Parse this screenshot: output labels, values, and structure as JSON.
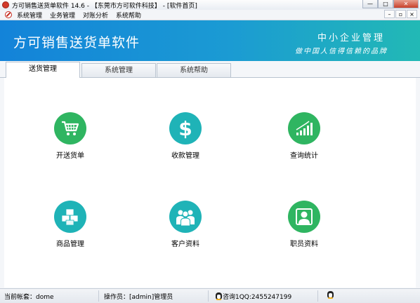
{
  "window": {
    "title": "方可销售送货单软件 14.6 - 【东莞市方可软件科技】 - [软件首页]",
    "min_label": "—",
    "max_label": "□",
    "close_label": "✕"
  },
  "menu": {
    "items": [
      {
        "label": "系统管理"
      },
      {
        "label": "业务管理"
      },
      {
        "label": "对账分析"
      },
      {
        "label": "系统帮助"
      }
    ],
    "mdi": [
      "–",
      "▫",
      "×"
    ]
  },
  "banner": {
    "app_name": "方可销售送货单软件",
    "tagline_main": "中小企业管理",
    "tagline_sub": "做中国人信得信赖的品牌"
  },
  "tabs": [
    {
      "label": "送货管理",
      "active": true
    },
    {
      "label": "系统管理",
      "active": false
    },
    {
      "label": "系统帮助",
      "active": false
    }
  ],
  "tiles": [
    {
      "label": "开送货单",
      "icon": "shopping-cart-icon",
      "color": "#2fb561"
    },
    {
      "label": "收款管理",
      "icon": "dollar-icon",
      "color": "#1fb3b7"
    },
    {
      "label": "查询统计",
      "icon": "bar-chart-icon",
      "color": "#2fb561"
    },
    {
      "label": "商品管理",
      "icon": "boxes-icon",
      "color": "#1fb3b7"
    },
    {
      "label": "客户资料",
      "icon": "customers-icon",
      "color": "#1fb3b7"
    },
    {
      "label": "职员资料",
      "icon": "employee-icon",
      "color": "#2fb561"
    }
  ],
  "status": {
    "account": "当前帐套：dome",
    "operator": "操作员：[admin]管理员",
    "qq": "咨询1QQ:2455247199"
  }
}
